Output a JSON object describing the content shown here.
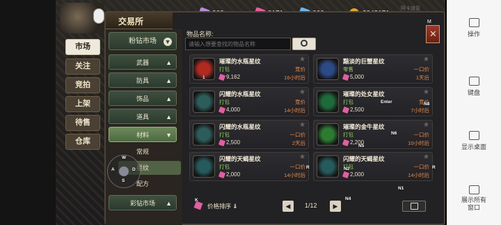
{
  "topbar": {
    "currencies": [
      {
        "icon": "purple-gem-icon",
        "value": "968",
        "color": "#b58bd8"
      },
      {
        "icon": "pink-gem-icon",
        "value": "8171",
        "color": "#e0609c"
      },
      {
        "icon": "blue-gem-icon",
        "value": "666",
        "color": "#6bb6ea"
      },
      {
        "icon": "gold-coin-icon",
        "value": "2843171",
        "color": "#e2a52c"
      }
    ],
    "faint_label": "阿卡迪亚"
  },
  "nav": {
    "items": [
      {
        "label": "市场",
        "active": true
      },
      {
        "label": "关注",
        "active": false
      },
      {
        "label": "竞拍",
        "active": false
      },
      {
        "label": "上架",
        "active": false
      },
      {
        "label": "待售",
        "active": false
      },
      {
        "label": "仓库",
        "active": false
      }
    ]
  },
  "panel": {
    "title": "交易所",
    "close_icon": "close-icon"
  },
  "categories": {
    "header": "粉钻市场",
    "items": [
      {
        "label": "武器",
        "arrow": "▲"
      },
      {
        "label": "防具",
        "arrow": "▲"
      },
      {
        "label": "饰品",
        "arrow": "▲"
      },
      {
        "label": "道具",
        "arrow": "▲"
      },
      {
        "label": "材料",
        "arrow": "▼",
        "selected": true
      }
    ],
    "subitems": [
      {
        "label": "常规",
        "selected": false
      },
      {
        "label": "星纹",
        "selected": true
      },
      {
        "label": "配方",
        "selected": false
      }
    ],
    "footer": "彩钻市场"
  },
  "search": {
    "label": "物品名称:",
    "placeholder": "请输入想要查找的物品名称"
  },
  "items": [
    {
      "name": "璀璨的水瓶星纹",
      "sub": "打包",
      "sub_color": "#8fd05a",
      "price": "9,162",
      "mode": "竞价",
      "time": "16小时后",
      "icon_color": "#b02a22",
      "badge": "1"
    },
    {
      "name": "黯淡的巨蟹星纹",
      "sub": "零售",
      "sub_color": "#8fd05a",
      "price": "5,000",
      "mode": "一口价",
      "time": "1天后",
      "icon_color": "#2b4a86",
      "badge": ""
    },
    {
      "name": "闪耀的水瓶星纹",
      "sub": "打包",
      "sub_color": "#8fd05a",
      "price": "4,000",
      "mode": "竞价",
      "time": "14小时后",
      "icon_color": "#2d5d5a",
      "badge": ""
    },
    {
      "name": "璀璨的处女星纹",
      "sub": "打包",
      "sub_color": "#8fd05a",
      "price": "2,500",
      "mode": "竞价",
      "time": "7小时后",
      "icon_color": "#1f6a3a",
      "badge": ""
    },
    {
      "name": "闪耀的水瓶星纹",
      "sub": "打包",
      "sub_color": "#8fd05a",
      "price": "2,500",
      "mode": "一口价",
      "time": "2天后",
      "icon_color": "#2d5d5a",
      "badge": ""
    },
    {
      "name": "璀璨的金牛星纹",
      "sub": "打包",
      "sub_color": "#8fd05a",
      "price": "2,200",
      "mode": "一口价",
      "time": "10小时后",
      "icon_color": "#2d7a32",
      "badge": ""
    },
    {
      "name": "闪耀的天蝎星纹",
      "sub": "打包",
      "sub_color": "#8fd05a",
      "price": "2,000",
      "mode": "一口价",
      "time": "14小时后",
      "icon_color": "#265a5c",
      "badge": ""
    },
    {
      "name": "闪耀的天蝎星纹",
      "sub": "打包",
      "sub_color": "#8fd05a",
      "price": "2,000",
      "mode": "一口价",
      "time": "14小时后",
      "icon_color": "#265a5c",
      "badge": ""
    }
  ],
  "footer": {
    "sort_label": "价格排序",
    "sort_icon": "down-arrow-icon",
    "page": "1/12"
  },
  "key_overlay": {
    "labels": [
      "M",
      "W",
      "A",
      "S",
      "D",
      "Enter",
      "N8",
      "N6",
      "N5",
      "N4",
      "N2",
      "N1",
      "R",
      "R",
      "K"
    ]
  },
  "emulator": {
    "buttons": [
      "操作",
      "键盘",
      "显示桌面",
      "展示所有窗口"
    ]
  }
}
